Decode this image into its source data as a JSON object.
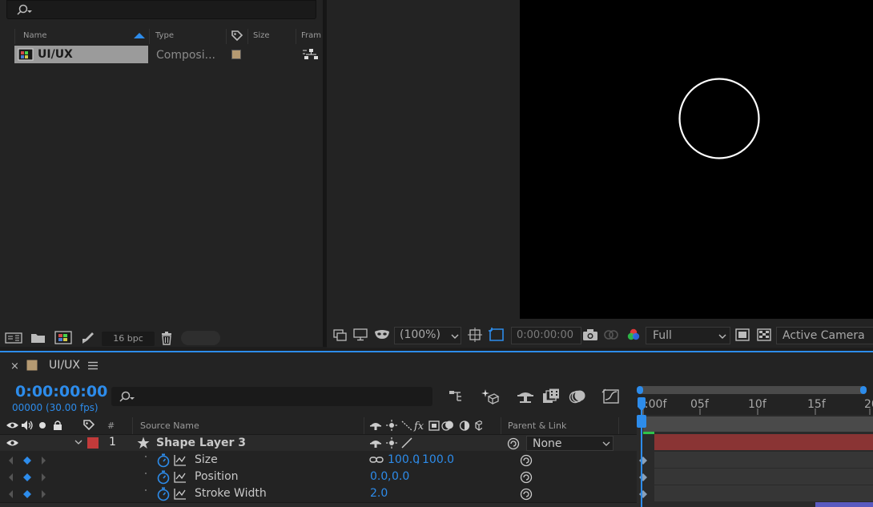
{
  "project": {
    "columns": {
      "name": "Name",
      "type": "Type",
      "size": "Size",
      "frame": "Fram"
    },
    "items": [
      {
        "name": "UI/UX",
        "type": "Composi..."
      }
    ],
    "bpc": "16 bpc"
  },
  "viewer": {
    "zoom": "(100%)",
    "timecode": "0:00:00:00",
    "resolution": "Full",
    "camera": "Active Camera"
  },
  "timeline": {
    "comp_tab": "UI/UX",
    "timecode": "0:00:00:00",
    "fps": "00000 (30.00 fps)",
    "columns": {
      "number": "#",
      "source_name": "Source Name",
      "parent_link": "Parent & Link"
    },
    "ruler": [
      "0:00f",
      "05f",
      "10f",
      "15f",
      "20"
    ],
    "layers": [
      {
        "index": "1",
        "name": "Shape Layer 3",
        "label_color": "#c23a3a",
        "parent": "None",
        "properties": [
          {
            "name": "Size",
            "value_a": "100.0",
            "value_b": "100.0",
            "linked": true
          },
          {
            "name": "Position",
            "value_a": "0.0",
            "value_b": "0.0",
            "linked": false
          },
          {
            "name": "Stroke Width",
            "value_a": "2.0",
            "value_b": "",
            "linked": false
          }
        ]
      }
    ]
  },
  "colors": {
    "accent": "#2d8ceb",
    "layer_bar": "#8a3434",
    "panel": "#232323"
  }
}
